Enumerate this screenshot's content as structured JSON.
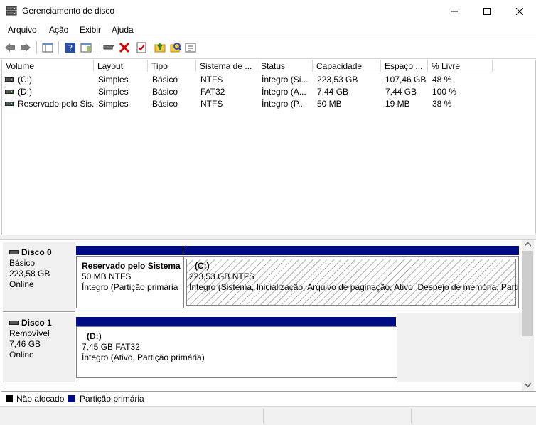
{
  "window": {
    "title": "Gerenciamento de disco"
  },
  "menu": [
    "Arquivo",
    "Ação",
    "Exibir",
    "Ajuda"
  ],
  "list": {
    "columns": [
      "Volume",
      "Layout",
      "Tipo",
      "Sistema de ...",
      "Status",
      "Capacidade",
      "Espaço ...",
      "% Livre"
    ],
    "rows": [
      [
        "(C:)",
        "Simples",
        "Básico",
        "NTFS",
        "Íntegro (Si...",
        "223,53 GB",
        "107,46 GB",
        "48 %"
      ],
      [
        "(D:)",
        "Simples",
        "Básico",
        "FAT32",
        "Íntegro (A...",
        "7,44 GB",
        "7,44 GB",
        "100 %"
      ],
      [
        "Reservado pelo Sis...",
        "Simples",
        "Básico",
        "NTFS",
        "Íntegro (P...",
        "50 MB",
        "19 MB",
        "38 %"
      ]
    ]
  },
  "disks": [
    {
      "name": "Disco 0",
      "type": "Básico",
      "size": "223,58 GB",
      "state": "Online",
      "partitions": [
        {
          "title": "Reservado pelo Sistema",
          "size": "50 MB NTFS",
          "status": "Íntegro (Partição primária"
        },
        {
          "title": "(C:)",
          "size": "223,53 GB NTFS",
          "status": "Íntegro (Sistema, Inicialização, Arquivo de paginação, Ativo, Despejo de memória, Parti"
        }
      ]
    },
    {
      "name": "Disco 1",
      "type": "Removível",
      "size": "7,46 GB",
      "state": "Online",
      "partitions": [
        {
          "title": "(D:)",
          "size": "7,45 GB FAT32",
          "status": "Íntegro (Ativo, Partição primária)"
        }
      ]
    }
  ],
  "legend": [
    {
      "label": "Não alocado",
      "color": "#000000"
    },
    {
      "label": "Partição primária",
      "color": "#000c84"
    }
  ]
}
